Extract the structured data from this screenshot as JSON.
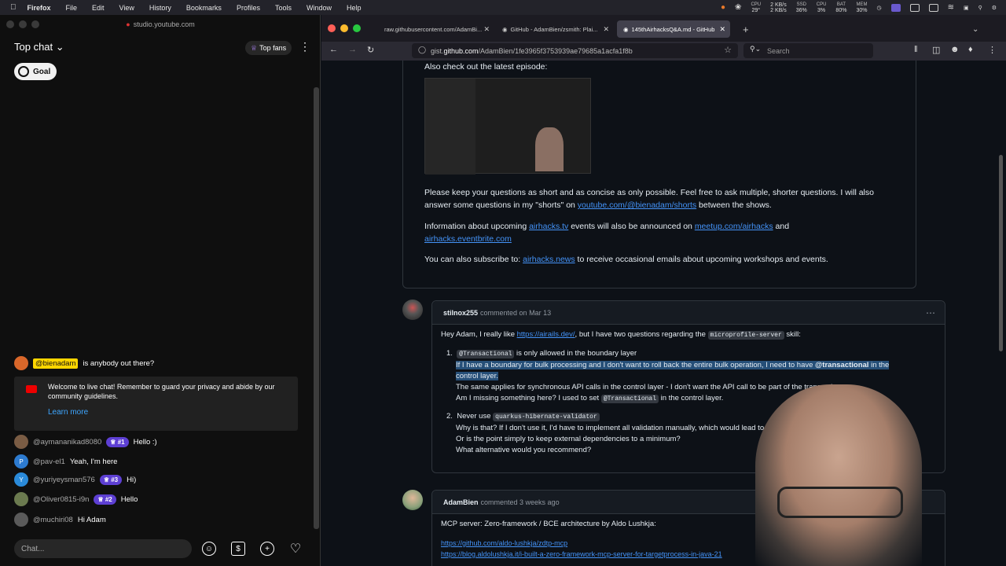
{
  "menubar": {
    "app": "Firefox",
    "items": [
      "File",
      "Edit",
      "View",
      "History",
      "Bookmarks",
      "Profiles",
      "Tools",
      "Window",
      "Help"
    ],
    "stats": [
      {
        "k": "CPU",
        "v": "29°"
      },
      {
        "k": "2 KB/s",
        "v": "2 KB/s"
      },
      {
        "k": "SSD",
        "v": "36%"
      },
      {
        "k": "CPU",
        "v": "3%"
      },
      {
        "k": "BAT",
        "v": "80%"
      },
      {
        "k": "MEM",
        "v": "30%"
      }
    ]
  },
  "youtube": {
    "url": "studio.youtube.com",
    "title": "Top chat",
    "top_fans": "Top fans",
    "goal": "Goal",
    "messages": [
      {
        "avatar_color": "#d9672a",
        "initial": "",
        "author": "@bienadam",
        "text": "is anybody out there?",
        "highlight": true
      },
      {
        "avatar_color": "#7a5c44",
        "initial": "",
        "author": "@aymananikad8080",
        "badge": "#1",
        "text": "Hello :)"
      },
      {
        "avatar_color": "#2d7bd0",
        "initial": "P",
        "author": "@pav-el1",
        "text": "Yeah, I'm here"
      },
      {
        "avatar_color": "#2a8ad9",
        "initial": "Y",
        "author": "@yuriyeysman576",
        "badge": "#3",
        "text": "Hi)"
      },
      {
        "avatar_color": "#6b7a4f",
        "initial": "",
        "author": "@Oliver0815-i9n",
        "badge": "#2",
        "text": "Hello"
      },
      {
        "avatar_color": "#5a5a5a",
        "initial": "",
        "author": "@muchiri08",
        "text": "Hi Adam"
      }
    ],
    "welcome": "Welcome to live chat! Remember to guard your privacy and abide by our community guidelines.",
    "learn_more": "Learn more",
    "chat_placeholder": "Chat..."
  },
  "browser": {
    "tabs": [
      "raw.githubusercontent.com/AdamBi...",
      "GitHub - AdamBien/zsmith: Plai...",
      "145thAirhacksQ&A.md - GitHub"
    ],
    "url_prefix": "gist.",
    "url_host": "github.com",
    "url_path": "/AdamBien/1fe3965f3753939ae79685a1acfa1f8b",
    "search": "Search"
  },
  "gist": {
    "latest": "Also check out the latest episode:",
    "p1a": "Please keep your questions as short and as concise as only possible. Feel free to ask multiple, shorter questions. I will also answer some questions in my \"shorts\" on ",
    "p1link": "youtube.com/@bienadam/shorts",
    "p1b": " between the shows.",
    "p2a": "Information about upcoming ",
    "p2l1": "airhacks.tv",
    "p2b": " events will also be announced on ",
    "p2l2": "meetup.com/airhacks",
    "p2c": " and ",
    "p2l3": "airhacks.eventbrite.com",
    "p3a": "You can also subscribe to: ",
    "p3l": "airhacks.news",
    "p3b": " to receive occasional emails about upcoming workshops and events.",
    "c1": {
      "author": "stilnox255",
      "meta": "commented on Mar 13",
      "intro_a": "Hey Adam, I really like ",
      "intro_link": "https://airails.dev/",
      "intro_b": ", but I have two questions regarding the ",
      "intro_code": "microprofile-server",
      "intro_c": " skill:",
      "i1_code": "@Transactional",
      "i1_text": " is only allowed in the boundary layer",
      "i1_sel_a": "If I have a boundary for bulk processing and I don't want to roll back the entire bulk operation, I need to have ",
      "i1_sel_b": "@transactional",
      "i1_sel_c": " in the control layer.",
      "i1_l3": "The same applies for synchronous API calls in the control layer - I don't want the API call to be part of the transaction.",
      "i1_l4a": "Am I missing something here? I used to set ",
      "i1_l4code": "@Transactional",
      "i1_l4b": " in the control layer.",
      "i2_a": "Never use ",
      "i2_code": "quarkus-hibernate-validator",
      "i2_l2": "Why is that? If I don't use it, I'd have to implement all validation manually, which would lead to",
      "i2_l3": "Or is the point simply to keep external dependencies to a minimum?",
      "i2_l4": "What alternative would you recommend?"
    },
    "c2": {
      "author": "AdamBien",
      "meta": "commented 3 weeks ago",
      "text": "MCP server: Zero-framework / BCE architecture by Aldo Lushkja:",
      "link1": "https://github.com/aldo-lushkja/zdtp-mcp",
      "link2": "https://blog.aldolushkja.it/i-built-a-zero-framework-mcp-server-for-targetprocess-in-java-21"
    }
  }
}
